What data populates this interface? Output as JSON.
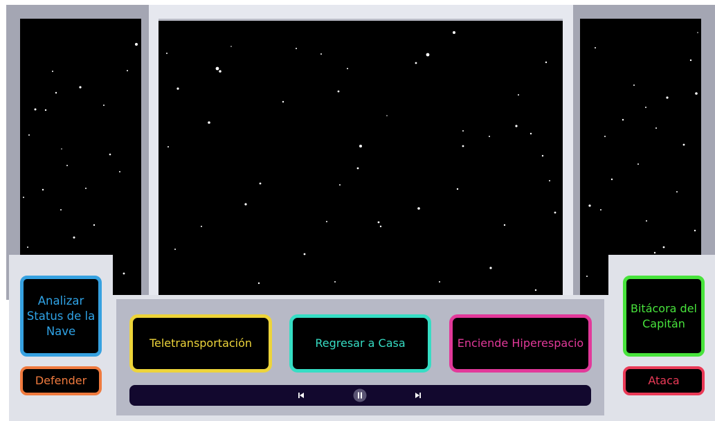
{
  "buttons": {
    "analyze": "Analizar Status de la Nave",
    "defend": "Defender",
    "log": "Bitácora del Capitán",
    "attack": "Ataca",
    "teleport": "Teletransportación",
    "home": "Regresar a Casa",
    "hyperspace": "Enciende Hiperespacio"
  },
  "player": {
    "controls": [
      "skip-back-icon",
      "pause-icon",
      "skip-forward-icon"
    ]
  },
  "colors": {
    "analyze": "#36a1e0",
    "defend": "#ef7a3e",
    "log": "#48e33c",
    "attack": "#ea3a57",
    "teleport": "#edd43a",
    "home": "#36ddc4",
    "hyperspace": "#e2399a",
    "player_bg": "#12082e"
  }
}
